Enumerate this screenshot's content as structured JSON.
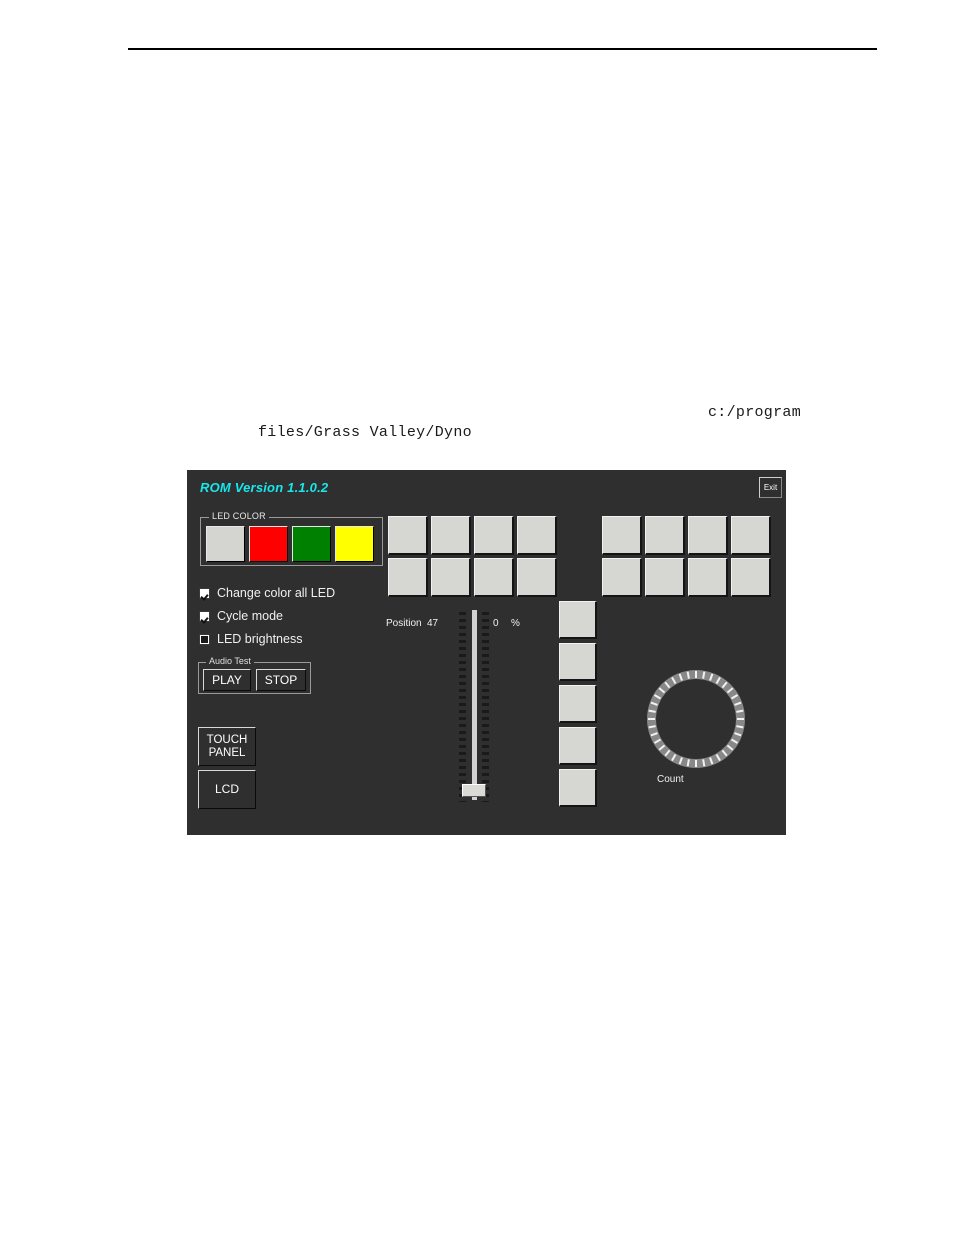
{
  "document": {
    "path_line_1": "c:/program",
    "path_line_2": "files/Grass Valley/Dyno"
  },
  "app": {
    "rom_version": "ROM Version 1.1.0.2",
    "exit_label": "Exit",
    "accent_color": "#16e8ee",
    "panel_background": "#2f2f2f",
    "led_color": {
      "legend": "LED COLOR",
      "swatches": [
        {
          "name": "white",
          "color": "#d4d4d0"
        },
        {
          "name": "red",
          "color": "#ff0000"
        },
        {
          "name": "green",
          "color": "#008000"
        },
        {
          "name": "yellow",
          "color": "#ffff00"
        }
      ]
    },
    "checkboxes": [
      {
        "label": "Change color all LED",
        "state": "checked"
      },
      {
        "label": "Cycle mode",
        "state": "checked"
      },
      {
        "label": "LED brightness",
        "state": "filled"
      }
    ],
    "audio_test": {
      "legend": "Audio Test",
      "play_label": "PLAY",
      "stop_label": "STOP"
    },
    "touch_panel_label": "TOUCH\nPANEL",
    "lcd_label": "LCD",
    "slider": {
      "position_label": "Position",
      "position_value": "47",
      "percent_value": "0",
      "percent_symbol": "%"
    },
    "count_dial": {
      "label": "Count",
      "tick_count": 36
    },
    "pad_grids": {
      "left_grid_count": 8,
      "right_grid_count": 8,
      "column_count": 5
    }
  }
}
